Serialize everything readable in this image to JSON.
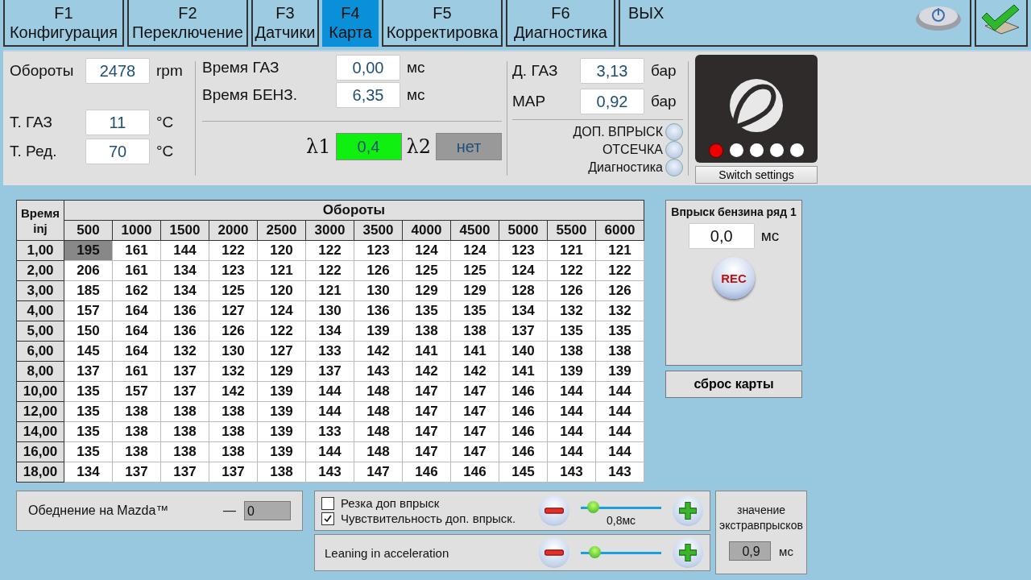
{
  "tabs": [
    {
      "key": "F1",
      "label": "Конфигурация",
      "selected": false
    },
    {
      "key": "F2",
      "label": "Переключение",
      "selected": false
    },
    {
      "key": "F3",
      "label": "Датчики",
      "selected": false
    },
    {
      "key": "F4",
      "label": "Карта",
      "selected": true
    },
    {
      "key": "F5",
      "label": "Корректировка",
      "selected": false
    },
    {
      "key": "F6",
      "label": "Диагностика",
      "selected": false
    }
  ],
  "exit_tab": {
    "label": "ВЫХ"
  },
  "readings": [
    {
      "label": "Обороты",
      "value": "2478",
      "unit": "rpm"
    },
    {
      "label": "Т. ГАЗ",
      "value": "11",
      "unit": "°C"
    },
    {
      "label": "Т. Ред.",
      "value": "70",
      "unit": "°C"
    }
  ],
  "injection_times": [
    {
      "label": "Время ГАЗ",
      "value": "0,00",
      "unit": "мс"
    },
    {
      "label": "Время БЕНЗ.",
      "value": "6,35",
      "unit": "мс"
    }
  ],
  "lambda": [
    {
      "label": "λ1",
      "value": "0,4",
      "active": true
    },
    {
      "label": "λ2",
      "value": "нет",
      "active": false
    }
  ],
  "pressures": [
    {
      "label": "Д. ГАЗ",
      "value": "3,13",
      "unit": "бар"
    },
    {
      "label": "MAP",
      "value": "0,92",
      "unit": "бар"
    }
  ],
  "indicators": [
    {
      "label": "ДОП. ВПРЫСК",
      "on": false
    },
    {
      "label": "ОТСЕЧКА",
      "on": false
    },
    {
      "label": "Диагностика",
      "on": false
    }
  ],
  "switch": {
    "leds": [
      {
        "on": true
      },
      {
        "on": false
      },
      {
        "on": false
      },
      {
        "on": false
      },
      {
        "on": false
      }
    ],
    "button": "Switch settings"
  },
  "map": {
    "corner": [
      "Время",
      "inj"
    ],
    "column_group": "Обороты",
    "columns": [
      "500",
      "1000",
      "1500",
      "2000",
      "2500",
      "3000",
      "3500",
      "4000",
      "4500",
      "5000",
      "5500",
      "6000"
    ],
    "rows": [
      {
        "label": "1,00",
        "cells": [
          {
            "t": "195",
            "selected": true
          },
          {
            "t": "161",
            "selected": false
          },
          {
            "t": "144",
            "selected": false
          },
          {
            "t": "122",
            "selected": false
          },
          {
            "t": "120",
            "selected": false
          },
          {
            "t": "122",
            "selected": false
          },
          {
            "t": "123",
            "selected": false
          },
          {
            "t": "124",
            "selected": false
          },
          {
            "t": "124",
            "selected": false
          },
          {
            "t": "123",
            "selected": false
          },
          {
            "t": "121",
            "selected": false
          },
          {
            "t": "121",
            "selected": false
          }
        ]
      },
      {
        "label": "2,00",
        "cells": [
          {
            "t": "206",
            "selected": false
          },
          {
            "t": "161",
            "selected": false
          },
          {
            "t": "134",
            "selected": false
          },
          {
            "t": "123",
            "selected": false
          },
          {
            "t": "121",
            "selected": false
          },
          {
            "t": "122",
            "selected": false
          },
          {
            "t": "126",
            "selected": false
          },
          {
            "t": "125",
            "selected": false
          },
          {
            "t": "125",
            "selected": false
          },
          {
            "t": "124",
            "selected": false
          },
          {
            "t": "122",
            "selected": false
          },
          {
            "t": "122",
            "selected": false
          }
        ]
      },
      {
        "label": "3,00",
        "cells": [
          {
            "t": "185",
            "selected": false
          },
          {
            "t": "162",
            "selected": false
          },
          {
            "t": "134",
            "selected": false
          },
          {
            "t": "125",
            "selected": false
          },
          {
            "t": "120",
            "selected": false
          },
          {
            "t": "121",
            "selected": false
          },
          {
            "t": "130",
            "selected": false
          },
          {
            "t": "129",
            "selected": false
          },
          {
            "t": "129",
            "selected": false
          },
          {
            "t": "128",
            "selected": false
          },
          {
            "t": "126",
            "selected": false
          },
          {
            "t": "126",
            "selected": false
          }
        ]
      },
      {
        "label": "4,00",
        "cells": [
          {
            "t": "157",
            "selected": false
          },
          {
            "t": "164",
            "selected": false
          },
          {
            "t": "136",
            "selected": false
          },
          {
            "t": "127",
            "selected": false
          },
          {
            "t": "124",
            "selected": false
          },
          {
            "t": "130",
            "selected": false
          },
          {
            "t": "136",
            "selected": false
          },
          {
            "t": "135",
            "selected": false
          },
          {
            "t": "135",
            "selected": false
          },
          {
            "t": "134",
            "selected": false
          },
          {
            "t": "132",
            "selected": false
          },
          {
            "t": "132",
            "selected": false
          }
        ]
      },
      {
        "label": "5,00",
        "cells": [
          {
            "t": "150",
            "selected": false
          },
          {
            "t": "164",
            "selected": false
          },
          {
            "t": "136",
            "selected": false
          },
          {
            "t": "126",
            "selected": false
          },
          {
            "t": "122",
            "selected": false
          },
          {
            "t": "134",
            "selected": false
          },
          {
            "t": "139",
            "selected": false
          },
          {
            "t": "138",
            "selected": false
          },
          {
            "t": "138",
            "selected": false
          },
          {
            "t": "137",
            "selected": false
          },
          {
            "t": "135",
            "selected": false
          },
          {
            "t": "135",
            "selected": false
          }
        ]
      },
      {
        "label": "6,00",
        "cells": [
          {
            "t": "145",
            "selected": false
          },
          {
            "t": "164",
            "selected": false
          },
          {
            "t": "132",
            "selected": false
          },
          {
            "t": "130",
            "selected": false
          },
          {
            "t": "127",
            "selected": false
          },
          {
            "t": "133",
            "selected": false
          },
          {
            "t": "142",
            "selected": false
          },
          {
            "t": "141",
            "selected": false
          },
          {
            "t": "141",
            "selected": false
          },
          {
            "t": "140",
            "selected": false
          },
          {
            "t": "138",
            "selected": false
          },
          {
            "t": "138",
            "selected": false
          }
        ]
      },
      {
        "label": "8,00",
        "cells": [
          {
            "t": "137",
            "selected": false
          },
          {
            "t": "161",
            "selected": false
          },
          {
            "t": "137",
            "selected": false
          },
          {
            "t": "132",
            "selected": false
          },
          {
            "t": "129",
            "selected": false
          },
          {
            "t": "137",
            "selected": false
          },
          {
            "t": "143",
            "selected": false
          },
          {
            "t": "142",
            "selected": false
          },
          {
            "t": "142",
            "selected": false
          },
          {
            "t": "141",
            "selected": false
          },
          {
            "t": "139",
            "selected": false
          },
          {
            "t": "139",
            "selected": false
          }
        ]
      },
      {
        "label": "10,00",
        "cells": [
          {
            "t": "135",
            "selected": false
          },
          {
            "t": "157",
            "selected": false
          },
          {
            "t": "137",
            "selected": false
          },
          {
            "t": "142",
            "selected": false
          },
          {
            "t": "139",
            "selected": false
          },
          {
            "t": "144",
            "selected": false
          },
          {
            "t": "148",
            "selected": false
          },
          {
            "t": "147",
            "selected": false
          },
          {
            "t": "147",
            "selected": false
          },
          {
            "t": "146",
            "selected": false
          },
          {
            "t": "144",
            "selected": false
          },
          {
            "t": "144",
            "selected": false
          }
        ]
      },
      {
        "label": "12,00",
        "cells": [
          {
            "t": "135",
            "selected": false
          },
          {
            "t": "138",
            "selected": false
          },
          {
            "t": "138",
            "selected": false
          },
          {
            "t": "138",
            "selected": false
          },
          {
            "t": "139",
            "selected": false
          },
          {
            "t": "144",
            "selected": false
          },
          {
            "t": "148",
            "selected": false
          },
          {
            "t": "147",
            "selected": false
          },
          {
            "t": "147",
            "selected": false
          },
          {
            "t": "146",
            "selected": false
          },
          {
            "t": "144",
            "selected": false
          },
          {
            "t": "144",
            "selected": false
          }
        ]
      },
      {
        "label": "14,00",
        "cells": [
          {
            "t": "135",
            "selected": false
          },
          {
            "t": "138",
            "selected": false
          },
          {
            "t": "138",
            "selected": false
          },
          {
            "t": "138",
            "selected": false
          },
          {
            "t": "139",
            "selected": false
          },
          {
            "t": "133",
            "selected": false
          },
          {
            "t": "148",
            "selected": false
          },
          {
            "t": "147",
            "selected": false
          },
          {
            "t": "147",
            "selected": false
          },
          {
            "t": "146",
            "selected": false
          },
          {
            "t": "144",
            "selected": false
          },
          {
            "t": "144",
            "selected": false
          }
        ]
      },
      {
        "label": "16,00",
        "cells": [
          {
            "t": "135",
            "selected": false
          },
          {
            "t": "138",
            "selected": false
          },
          {
            "t": "138",
            "selected": false
          },
          {
            "t": "138",
            "selected": false
          },
          {
            "t": "139",
            "selected": false
          },
          {
            "t": "144",
            "selected": false
          },
          {
            "t": "148",
            "selected": false
          },
          {
            "t": "147",
            "selected": false
          },
          {
            "t": "147",
            "selected": false
          },
          {
            "t": "146",
            "selected": false
          },
          {
            "t": "144",
            "selected": false
          },
          {
            "t": "144",
            "selected": false
          }
        ]
      },
      {
        "label": "18,00",
        "cells": [
          {
            "t": "134",
            "selected": false
          },
          {
            "t": "137",
            "selected": false
          },
          {
            "t": "137",
            "selected": false
          },
          {
            "t": "137",
            "selected": false
          },
          {
            "t": "138",
            "selected": false
          },
          {
            "t": "143",
            "selected": false
          },
          {
            "t": "147",
            "selected": false
          },
          {
            "t": "146",
            "selected": false
          },
          {
            "t": "146",
            "selected": false
          },
          {
            "t": "145",
            "selected": false
          },
          {
            "t": "143",
            "selected": false
          },
          {
            "t": "143",
            "selected": false
          }
        ]
      }
    ]
  },
  "petrol_panel": {
    "title": "Впрыск бензина ряд 1",
    "value": "0,0",
    "unit": "мс",
    "rec_button": "REC"
  },
  "reset_button": "сброс карты",
  "mazda": {
    "label": "Обеднение на Mazda™",
    "sign": "—",
    "value": "0"
  },
  "extra_injection": {
    "options": [
      {
        "label": "Резка доп впрыск",
        "checked": false
      },
      {
        "label": "Чувствительность доп. впрыск.",
        "checked": true
      }
    ],
    "level": 0.15,
    "reading": "0,8мс"
  },
  "leaning": {
    "label": "Leaning in acceleration",
    "level": 0.17
  },
  "extra_value": {
    "label": "значение экстравпрысков",
    "value": "0,9",
    "unit": "мс"
  }
}
